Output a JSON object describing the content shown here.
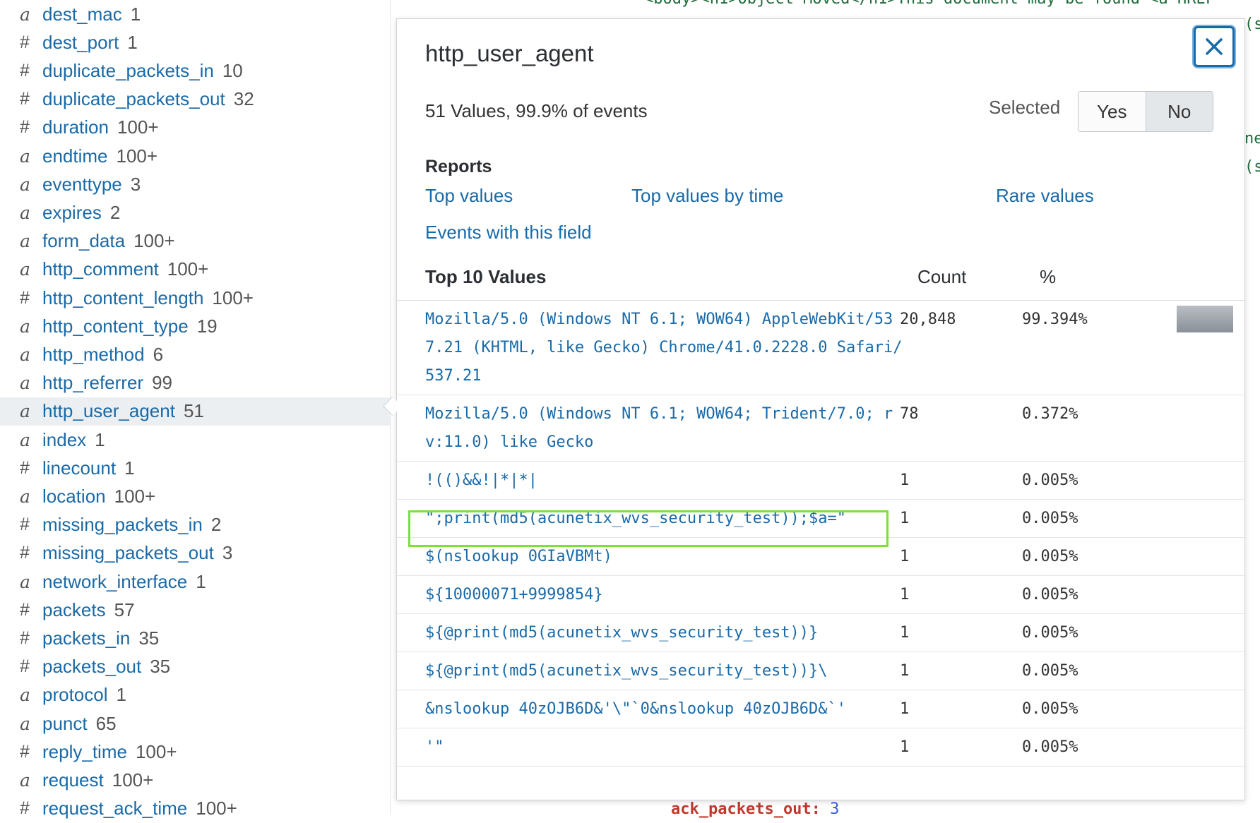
{
  "sidebar": {
    "fields": [
      {
        "type": "a",
        "name": "dest_mac",
        "count": "1"
      },
      {
        "type": "#",
        "name": "dest_port",
        "count": "1"
      },
      {
        "type": "#",
        "name": "duplicate_packets_in",
        "count": "10"
      },
      {
        "type": "#",
        "name": "duplicate_packets_out",
        "count": "32"
      },
      {
        "type": "#",
        "name": "duration",
        "count": "100+"
      },
      {
        "type": "a",
        "name": "endtime",
        "count": "100+"
      },
      {
        "type": "a",
        "name": "eventtype",
        "count": "3"
      },
      {
        "type": "a",
        "name": "expires",
        "count": "2"
      },
      {
        "type": "a",
        "name": "form_data",
        "count": "100+"
      },
      {
        "type": "a",
        "name": "http_comment",
        "count": "100+"
      },
      {
        "type": "#",
        "name": "http_content_length",
        "count": "100+"
      },
      {
        "type": "a",
        "name": "http_content_type",
        "count": "19"
      },
      {
        "type": "a",
        "name": "http_method",
        "count": "6"
      },
      {
        "type": "a",
        "name": "http_referrer",
        "count": "99"
      },
      {
        "type": "a",
        "name": "http_user_agent",
        "count": "51"
      },
      {
        "type": "a",
        "name": "index",
        "count": "1"
      },
      {
        "type": "#",
        "name": "linecount",
        "count": "1"
      },
      {
        "type": "a",
        "name": "location",
        "count": "100+"
      },
      {
        "type": "#",
        "name": "missing_packets_in",
        "count": "2"
      },
      {
        "type": "#",
        "name": "missing_packets_out",
        "count": "3"
      },
      {
        "type": "a",
        "name": "network_interface",
        "count": "1"
      },
      {
        "type": "#",
        "name": "packets",
        "count": "57"
      },
      {
        "type": "#",
        "name": "packets_in",
        "count": "35"
      },
      {
        "type": "#",
        "name": "packets_out",
        "count": "35"
      },
      {
        "type": "a",
        "name": "protocol",
        "count": "1"
      },
      {
        "type": "a",
        "name": "punct",
        "count": "65"
      },
      {
        "type": "#",
        "name": "reply_time",
        "count": "100+"
      },
      {
        "type": "a",
        "name": "request",
        "count": "100+"
      },
      {
        "type": "#",
        "name": "request_ack_time",
        "count": "100+"
      }
    ],
    "selected_index": 14
  },
  "background": {
    "top_line": "<body><h1>Object Moved</h1>This document may be found <a HREF",
    "right_1": "(s",
    "right_2": "ne",
    "right_3": "(s",
    "bottom_key": "ack_packets_out:",
    "bottom_val": "3"
  },
  "popup": {
    "title": "http_user_agent",
    "summary": "51 Values, 99.9% of events",
    "selected_label": "Selected",
    "toggle": {
      "yes": "Yes",
      "no": "No",
      "active": "No"
    },
    "reports_title": "Reports",
    "reports": {
      "top_values": "Top values",
      "top_values_by_time": "Top values by time",
      "rare_values": "Rare values",
      "events_with_field": "Events with this field"
    },
    "table": {
      "headers": {
        "value": "Top 10 Values",
        "count": "Count",
        "pct": "%"
      },
      "rows": [
        {
          "value": "Mozilla/5.0 (Windows NT 6.1; WOW64) AppleWebKit/537.21 (KHTML, like Gecko) Chrome/41.0.2228.0 Safari/537.21",
          "count": "20,848",
          "pct": "99.394%",
          "fraction": 0.99394
        },
        {
          "value": "Mozilla/5.0 (Windows NT 6.1; WOW64; Trident/7.0; rv:11.0) like Gecko",
          "count": "78",
          "pct": "0.372%",
          "fraction": 0.00372
        },
        {
          "value": "!(()&&!|*|*|",
          "count": "1",
          "pct": "0.005%",
          "fraction": 5e-05
        },
        {
          "value": "\";print(md5(acunetix_wvs_security_test));$a=\"",
          "count": "1",
          "pct": "0.005%",
          "fraction": 5e-05
        },
        {
          "value": "$(nslookup 0GIaVBMt)",
          "count": "1",
          "pct": "0.005%",
          "fraction": 5e-05
        },
        {
          "value": "${10000071+9999854}",
          "count": "1",
          "pct": "0.005%",
          "fraction": 5e-05
        },
        {
          "value": "${@print(md5(acunetix_wvs_security_test))}",
          "count": "1",
          "pct": "0.005%",
          "fraction": 5e-05
        },
        {
          "value": "${@print(md5(acunetix_wvs_security_test))}\\",
          "count": "1",
          "pct": "0.005%",
          "fraction": 5e-05
        },
        {
          "value": "&nslookup 40zOJB6D&'\\\"`0&nslookup 40zOJB6D&`'",
          "count": "1",
          "pct": "0.005%",
          "fraction": 5e-05
        },
        {
          "value": "'\"",
          "count": "1",
          "pct": "0.005%",
          "fraction": 5e-05
        }
      ]
    }
  },
  "colors": {
    "link": "#1a6aa8",
    "highlight": "#76e23a",
    "selected_row": "#eceff2"
  }
}
